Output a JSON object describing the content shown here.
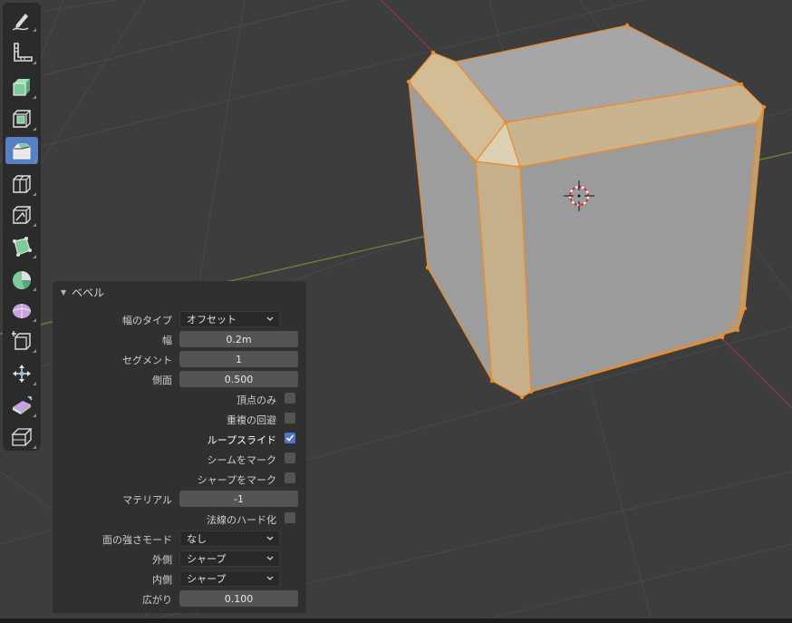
{
  "colors": {
    "viewport_bg": "#3d3d3d",
    "grid": "#4a4a4a",
    "x_axis": "#8b3b46",
    "y_axis": "#6a8e2f",
    "bevel_face": "#c9b48f",
    "cube_face": "#9b9b9b",
    "edge_select": "#f08a24",
    "panel_bg": "#303030",
    "active_tool": "#5680c2"
  },
  "toolbar": {
    "tools": [
      {
        "icon": "annotate-icon"
      },
      {
        "icon": "measure-icon"
      },
      {
        "icon": "extrude-region-icon"
      },
      {
        "icon": "inset-faces-icon"
      },
      {
        "icon": "bevel-icon",
        "active": true
      },
      {
        "icon": "loop-cut-icon"
      },
      {
        "icon": "knife-icon"
      },
      {
        "icon": "poly-build-icon"
      },
      {
        "icon": "spin-icon"
      },
      {
        "icon": "smooth-icon"
      },
      {
        "icon": "edge-slide-icon"
      },
      {
        "icon": "shrink-fatten-icon"
      },
      {
        "icon": "shear-icon"
      },
      {
        "icon": "rip-region-icon"
      }
    ]
  },
  "panel": {
    "title": "ベベル",
    "width_type": {
      "label": "幅のタイプ",
      "value": "オフセット"
    },
    "width": {
      "label": "幅",
      "value": "0.2m"
    },
    "segments": {
      "label": "セグメント",
      "value": "1"
    },
    "profile": {
      "label": "側面",
      "value": "0.500"
    },
    "vertex_only": {
      "label": "頂点のみ",
      "checked": false
    },
    "clamp_overlap": {
      "label": "重複の回避",
      "checked": false
    },
    "loop_slide": {
      "label": "ループスライド",
      "checked": true
    },
    "mark_seam": {
      "label": "シームをマーク",
      "checked": false
    },
    "mark_sharp": {
      "label": "シャープをマーク",
      "checked": false
    },
    "material": {
      "label": "マテリアル",
      "value": "-1"
    },
    "harden_normals": {
      "label": "法線のハード化",
      "checked": false
    },
    "face_strength": {
      "label": "面の強さモード",
      "value": "なし"
    },
    "miter_outer": {
      "label": "外側",
      "value": "シャープ"
    },
    "miter_inner": {
      "label": "内側",
      "value": "シャープ"
    },
    "spread": {
      "label": "広がり",
      "value": "0.100"
    }
  }
}
